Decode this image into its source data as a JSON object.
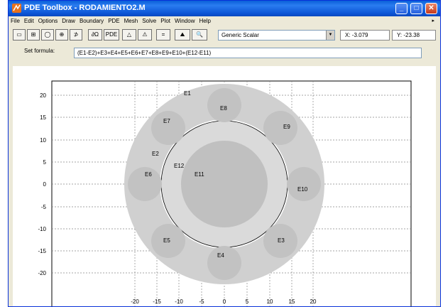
{
  "window": {
    "title": "PDE Toolbox - RODAMIENTO2.M",
    "controls": {
      "minimize": "_",
      "maximize": "□",
      "close": "✕"
    }
  },
  "menu": {
    "items": [
      "File",
      "Edit",
      "Options",
      "Draw",
      "Boundary",
      "PDE",
      "Mesh",
      "Solve",
      "Plot",
      "Window",
      "Help"
    ],
    "overflow_arrow": "▸"
  },
  "toolbar": {
    "buttons": [
      {
        "name": "draw-rectangle-icon",
        "glyph": "▭"
      },
      {
        "name": "draw-centered-rectangle-icon",
        "glyph": "⊞"
      },
      {
        "name": "draw-ellipse-icon",
        "glyph": "◯"
      },
      {
        "name": "draw-centered-ellipse-icon",
        "glyph": "⊕"
      },
      {
        "name": "draw-polygon-icon",
        "glyph": "⊅"
      },
      {
        "name": "boundary-mode-icon",
        "glyph": "∂Ω"
      },
      {
        "name": "pde-specification-icon",
        "glyph": "PDE"
      },
      {
        "name": "initialize-mesh-icon",
        "glyph": "△"
      },
      {
        "name": "refine-mesh-icon",
        "glyph": "⚠"
      },
      {
        "name": "solve-pde-icon",
        "glyph": "="
      },
      {
        "name": "plot-solution-icon",
        "glyph": "⛰"
      },
      {
        "name": "zoom-icon",
        "glyph": "🔍"
      }
    ],
    "application_mode": "Generic Scalar",
    "x_readout": "X: -3.079",
    "y_readout": "Y: -23.38"
  },
  "formula": {
    "label": "Set formula:",
    "value": "(E1-E2)+E3+E4+E5+E6+E7+E8+E9+E10+(E12-E11)"
  },
  "geometry": {
    "x_ticks": [
      "-20",
      "-15",
      "-10",
      "-5",
      "0",
      "5",
      "10",
      "15",
      "20"
    ],
    "y_ticks": [
      "20",
      "15",
      "10",
      "5",
      "0",
      "-5",
      "-10",
      "-15",
      "-20"
    ],
    "regions": {
      "E1": "E1",
      "E2": "E2",
      "E3": "E3",
      "E4": "E4",
      "E5": "E5",
      "E6": "E6",
      "E7": "E7",
      "E8": "E8",
      "E9": "E9",
      "E10": "E10",
      "E11": "E11",
      "E12": "E12"
    },
    "colors": {
      "outer_ring": "#d0d0d0",
      "balls": "#c2c2c2",
      "inner_disk": "#c0c0c0",
      "grid": "#888888"
    }
  }
}
